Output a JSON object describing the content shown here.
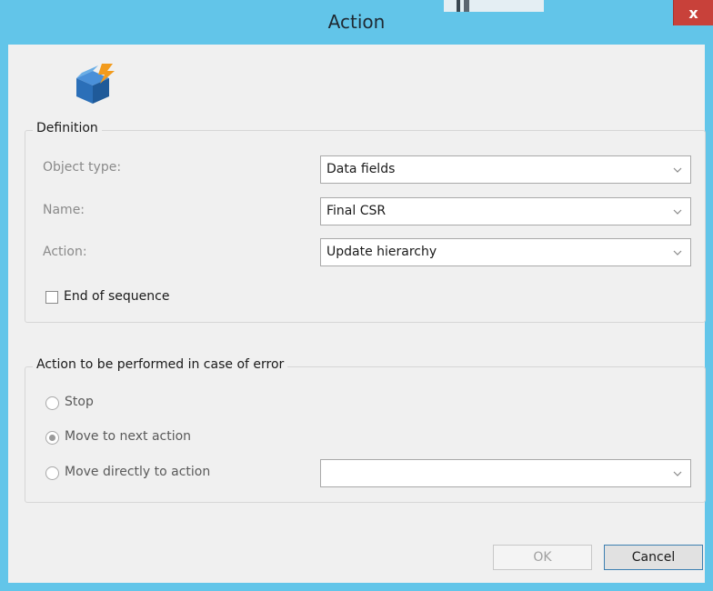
{
  "window": {
    "title": "Action",
    "close_label": "x"
  },
  "colors": {
    "titlebar": "#62c5e9",
    "close": "#c8413a",
    "client": "#f0f0f0"
  },
  "icons": {
    "app": "package-lightning-icon",
    "close": "close-icon",
    "dropdown": "chevron-down-icon"
  },
  "definition": {
    "title": "Definition",
    "object_type": {
      "label": "Object type:",
      "value": "Data fields"
    },
    "name": {
      "label": "Name:",
      "value": "Final CSR"
    },
    "action": {
      "label": "Action:",
      "value": "Update hierarchy"
    },
    "end_of_sequence": {
      "label": "End of sequence",
      "checked": false
    }
  },
  "error_handling": {
    "title": "Action to be performed in case of error",
    "options": [
      {
        "label": "Stop",
        "checked": false
      },
      {
        "label": "Move to next action",
        "checked": true
      },
      {
        "label": "Move directly to action",
        "checked": false
      }
    ],
    "target_action_value": ""
  },
  "buttons": {
    "ok": "OK",
    "cancel": "Cancel"
  }
}
